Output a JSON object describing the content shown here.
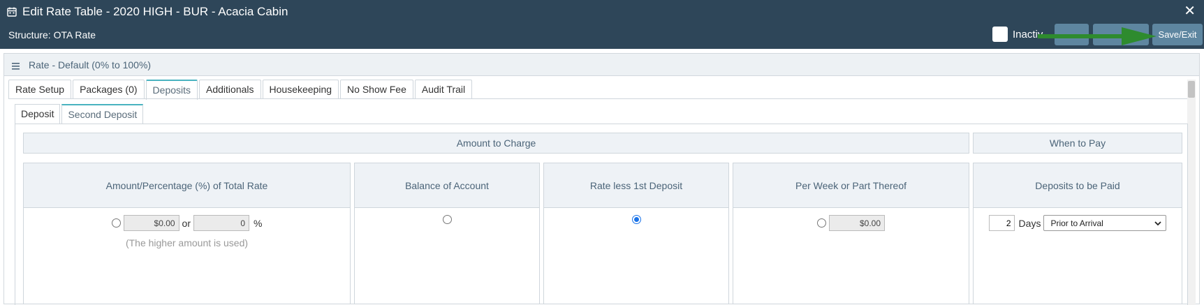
{
  "header": {
    "title": "Edit Rate Table - 2020 HIGH - BUR - Acacia Cabin",
    "close_glyph": "✕",
    "structure": "Structure: OTA Rate",
    "inactive_label": "Inactiv",
    "save_exit_label": "Save/Exit"
  },
  "panel": {
    "title": "Rate - Default (0% to 100%)"
  },
  "tabs": [
    "Rate Setup",
    "Packages (0)",
    "Deposits",
    "Additionals",
    "Housekeeping",
    "No Show Fee",
    "Audit Trail"
  ],
  "subtabs": [
    "Deposit",
    "Second Deposit"
  ],
  "groups": {
    "amount_to_charge": "Amount to Charge",
    "when_to_pay": "When to Pay"
  },
  "columns": {
    "amount_pct": {
      "header": "Amount/Percentage (%) of Total Rate",
      "amount": "$0.00",
      "or_label": "or",
      "percent": "0",
      "percent_sign": "%",
      "note": "(The higher amount is used)",
      "selected": false
    },
    "balance": {
      "header": "Balance of Account",
      "selected": false
    },
    "rate_less": {
      "header": "Rate less 1st Deposit",
      "selected": true
    },
    "per_week": {
      "header": "Per Week or Part Thereof",
      "amount": "$0.00",
      "selected": false
    },
    "deposits_paid": {
      "header": "Deposits to be Paid",
      "days": "2",
      "days_label": "Days",
      "timing": "Prior to Arrival"
    }
  },
  "colors": {
    "header_bg": "#2e4659",
    "button_bg": "#5e86a0",
    "tab_accent": "#49b3c0",
    "arrow_green": "#2e8b2e"
  },
  "icons": [
    "calendar-icon",
    "close-icon",
    "menu-icon",
    "chevron-down-icon",
    "arrow-annotation"
  ]
}
